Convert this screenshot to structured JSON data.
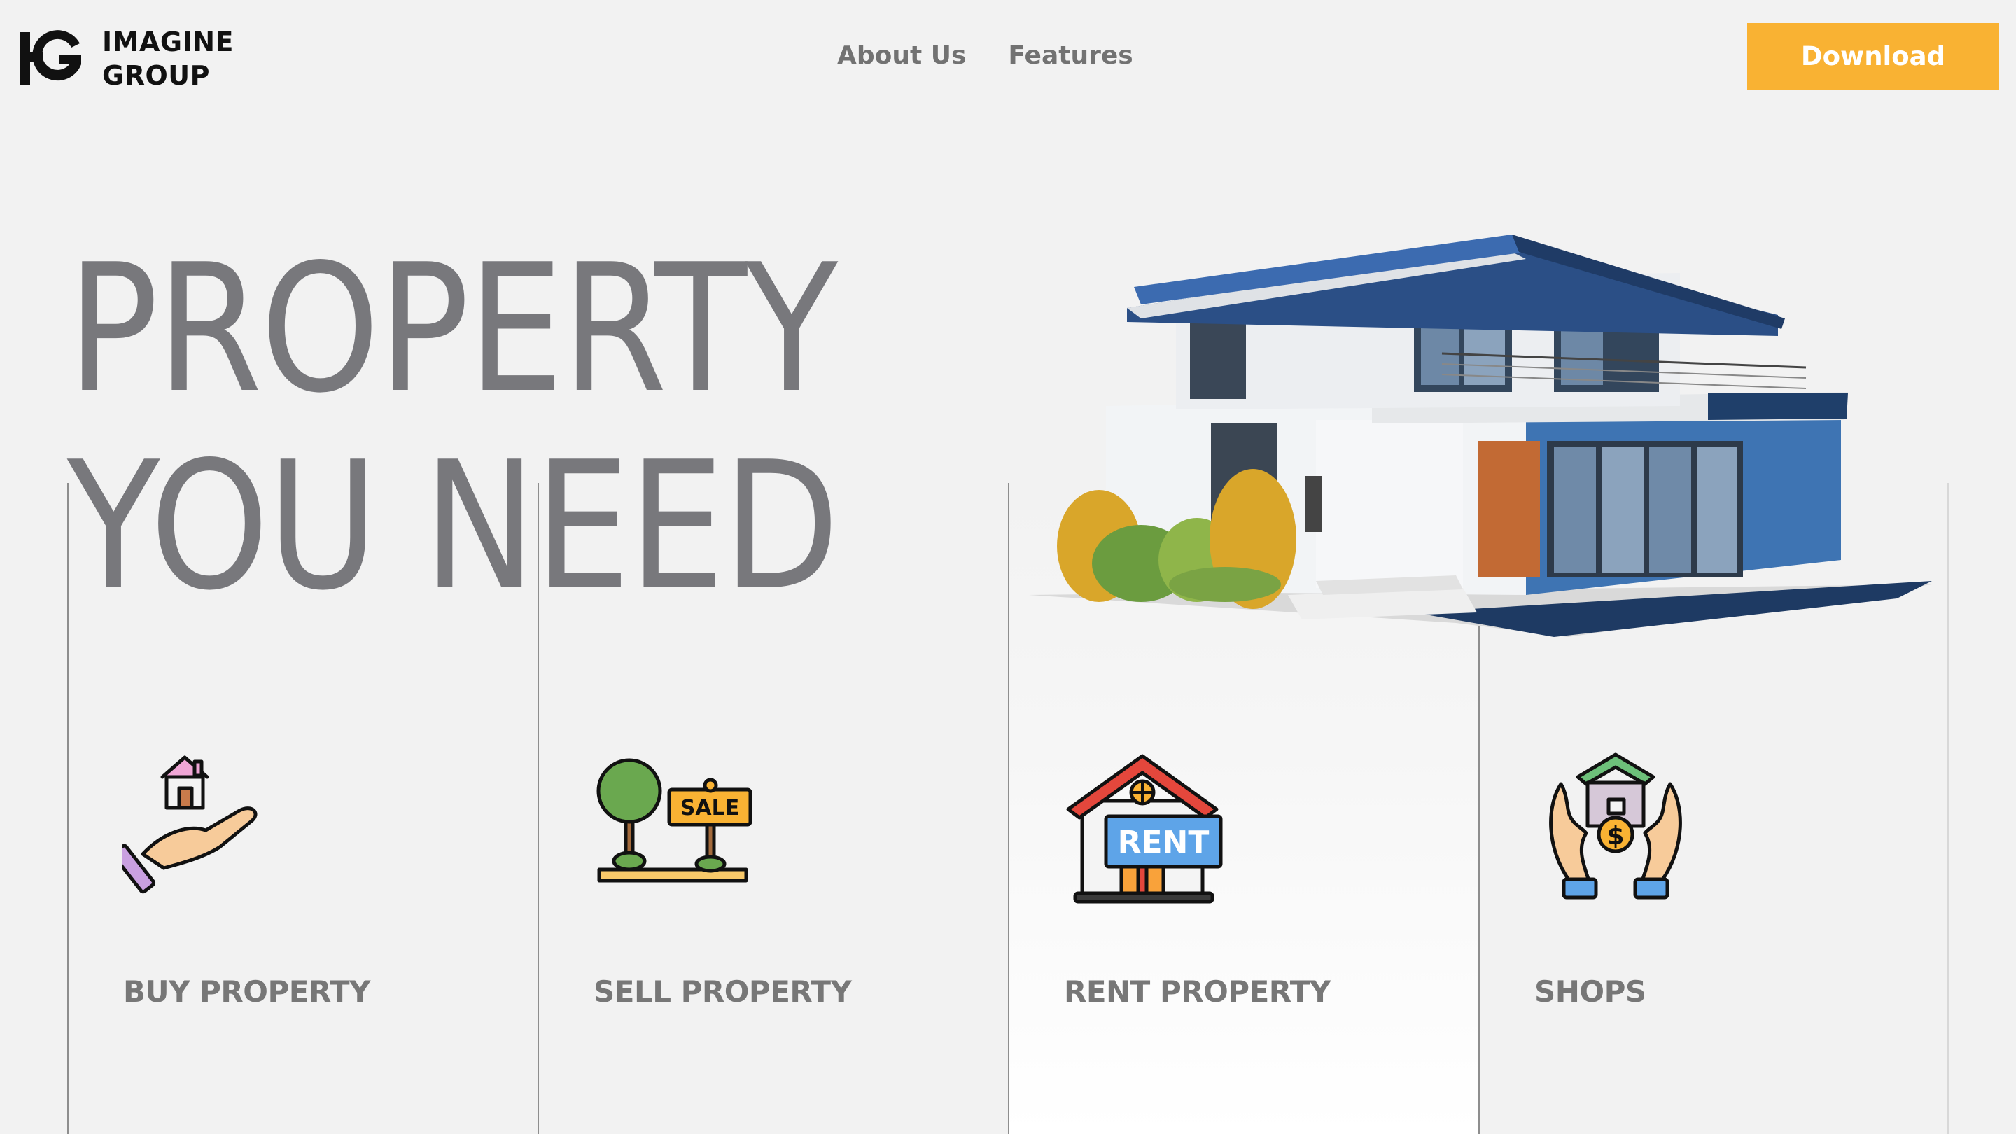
{
  "header": {
    "logo_text_line1": "IMAGINE",
    "logo_text_line2": "GROUP",
    "nav": [
      {
        "label": "About Us"
      },
      {
        "label": "Features"
      }
    ],
    "download_label": "Download"
  },
  "hero": {
    "title_line1": "PROPERTY",
    "title_line2": "YOU NEED"
  },
  "cards": [
    {
      "label": "BUY PROPERTY",
      "icon": "hand-house-icon"
    },
    {
      "label": "SELL PROPERTY",
      "icon": "sale-sign-icon"
    },
    {
      "label": "RENT PROPERTY",
      "icon": "rent-house-icon"
    },
    {
      "label": "SHOPS",
      "icon": "hands-house-dollar-icon"
    }
  ],
  "icons": {
    "rent_sign_text": "RENT",
    "sale_sign_text": "SALE",
    "dollar_symbol": "$"
  },
  "colors": {
    "accent": "#f9b233",
    "background": "#f2f2f2",
    "title": "#78787c",
    "nav_text": "#727272",
    "label_text": "#777777"
  }
}
